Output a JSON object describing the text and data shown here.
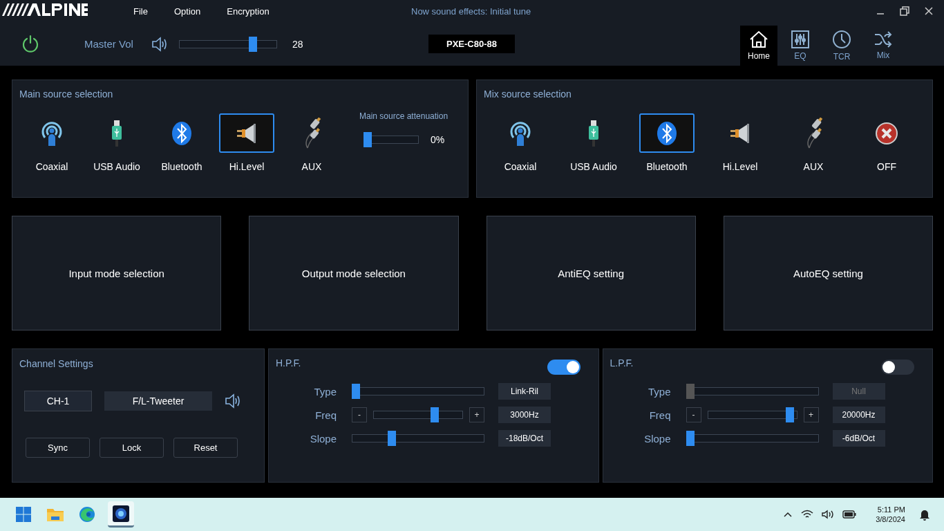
{
  "app": {
    "menu": [
      "File",
      "Option",
      "Encryption"
    ],
    "status": "Now sound effects: Initial tune"
  },
  "toolbar": {
    "power_on": true,
    "master_label": "Master Vol",
    "master_volume": {
      "level": 0.78
    },
    "master_value": "28",
    "device": "PXE-C80-88",
    "nav": [
      {
        "label": "Home",
        "kind": "home",
        "selected": true
      },
      {
        "label": "EQ",
        "kind": "eq",
        "selected": false
      },
      {
        "label": "TCR",
        "kind": "clock",
        "selected": false
      },
      {
        "label": "Mix",
        "kind": "shuffle",
        "selected": false
      }
    ]
  },
  "main_source": {
    "title": "Main source selection",
    "items": [
      {
        "label": "Coaxial",
        "kind": "coaxial",
        "selected": false
      },
      {
        "label": "USB Audio",
        "kind": "usb",
        "selected": false
      },
      {
        "label": "Bluetooth",
        "kind": "bluetooth",
        "selected": false
      },
      {
        "label": "Hi.Level",
        "kind": "speaker",
        "selected": true
      },
      {
        "label": "AUX",
        "kind": "aux",
        "selected": false
      }
    ],
    "attenuation_label": "Main source attenuation",
    "attenuation": {
      "level": 0
    },
    "attenuation_value": "0%"
  },
  "mix_source": {
    "title": "Mix source selection",
    "items": [
      {
        "label": "Coaxial",
        "kind": "coaxial",
        "selected": false
      },
      {
        "label": "USB Audio",
        "kind": "usb",
        "selected": false
      },
      {
        "label": "Bluetooth",
        "kind": "bluetooth",
        "selected": true
      },
      {
        "label": "Hi.Level",
        "kind": "speaker",
        "selected": false
      },
      {
        "label": "AUX",
        "kind": "aux",
        "selected": false
      },
      {
        "label": "OFF",
        "kind": "off",
        "selected": false
      }
    ]
  },
  "mode_cards": [
    "Input mode selection",
    "Output mode selection",
    "AntiEQ setting",
    "AutoEQ setting"
  ],
  "channel": {
    "title": "Channel Settings",
    "channel": "CH-1",
    "speaker": "F/L-Tweeter",
    "buttons": [
      "Sync",
      "Lock",
      "Reset"
    ]
  },
  "filters": [
    {
      "title": "H.P.F.",
      "on": true,
      "rows": [
        {
          "label": "Type",
          "kind": "slider",
          "level": 0.0,
          "value": "Link-Ril",
          "disabled": false
        },
        {
          "label": "Freq",
          "kind": "stepper",
          "minus": "-",
          "plus": "+",
          "level": 0.7,
          "value": "3000Hz",
          "disabled": false
        },
        {
          "label": "Slope",
          "kind": "slider",
          "level": 0.29,
          "value": "-18dB/Oct",
          "disabled": false
        }
      ]
    },
    {
      "title": "L.P.F.",
      "on": false,
      "rows": [
        {
          "label": "Type",
          "kind": "slider",
          "level": 0.0,
          "value": "Null",
          "disabled": true
        },
        {
          "label": "Freq",
          "kind": "stepper",
          "minus": "-",
          "plus": "+",
          "level": 0.96,
          "value": "20000Hz",
          "disabled": false
        },
        {
          "label": "Slope",
          "kind": "slider",
          "level": 0.0,
          "value": "-6dB/Oct",
          "disabled": false
        }
      ]
    }
  ],
  "taskbar": {
    "apps": [
      {
        "kind": "start",
        "selected": false
      },
      {
        "kind": "folder",
        "selected": false
      },
      {
        "kind": "browser",
        "selected": false
      },
      {
        "kind": "app",
        "selected": true
      }
    ],
    "time": "5:11 PM",
    "date": "3/8/2024"
  }
}
